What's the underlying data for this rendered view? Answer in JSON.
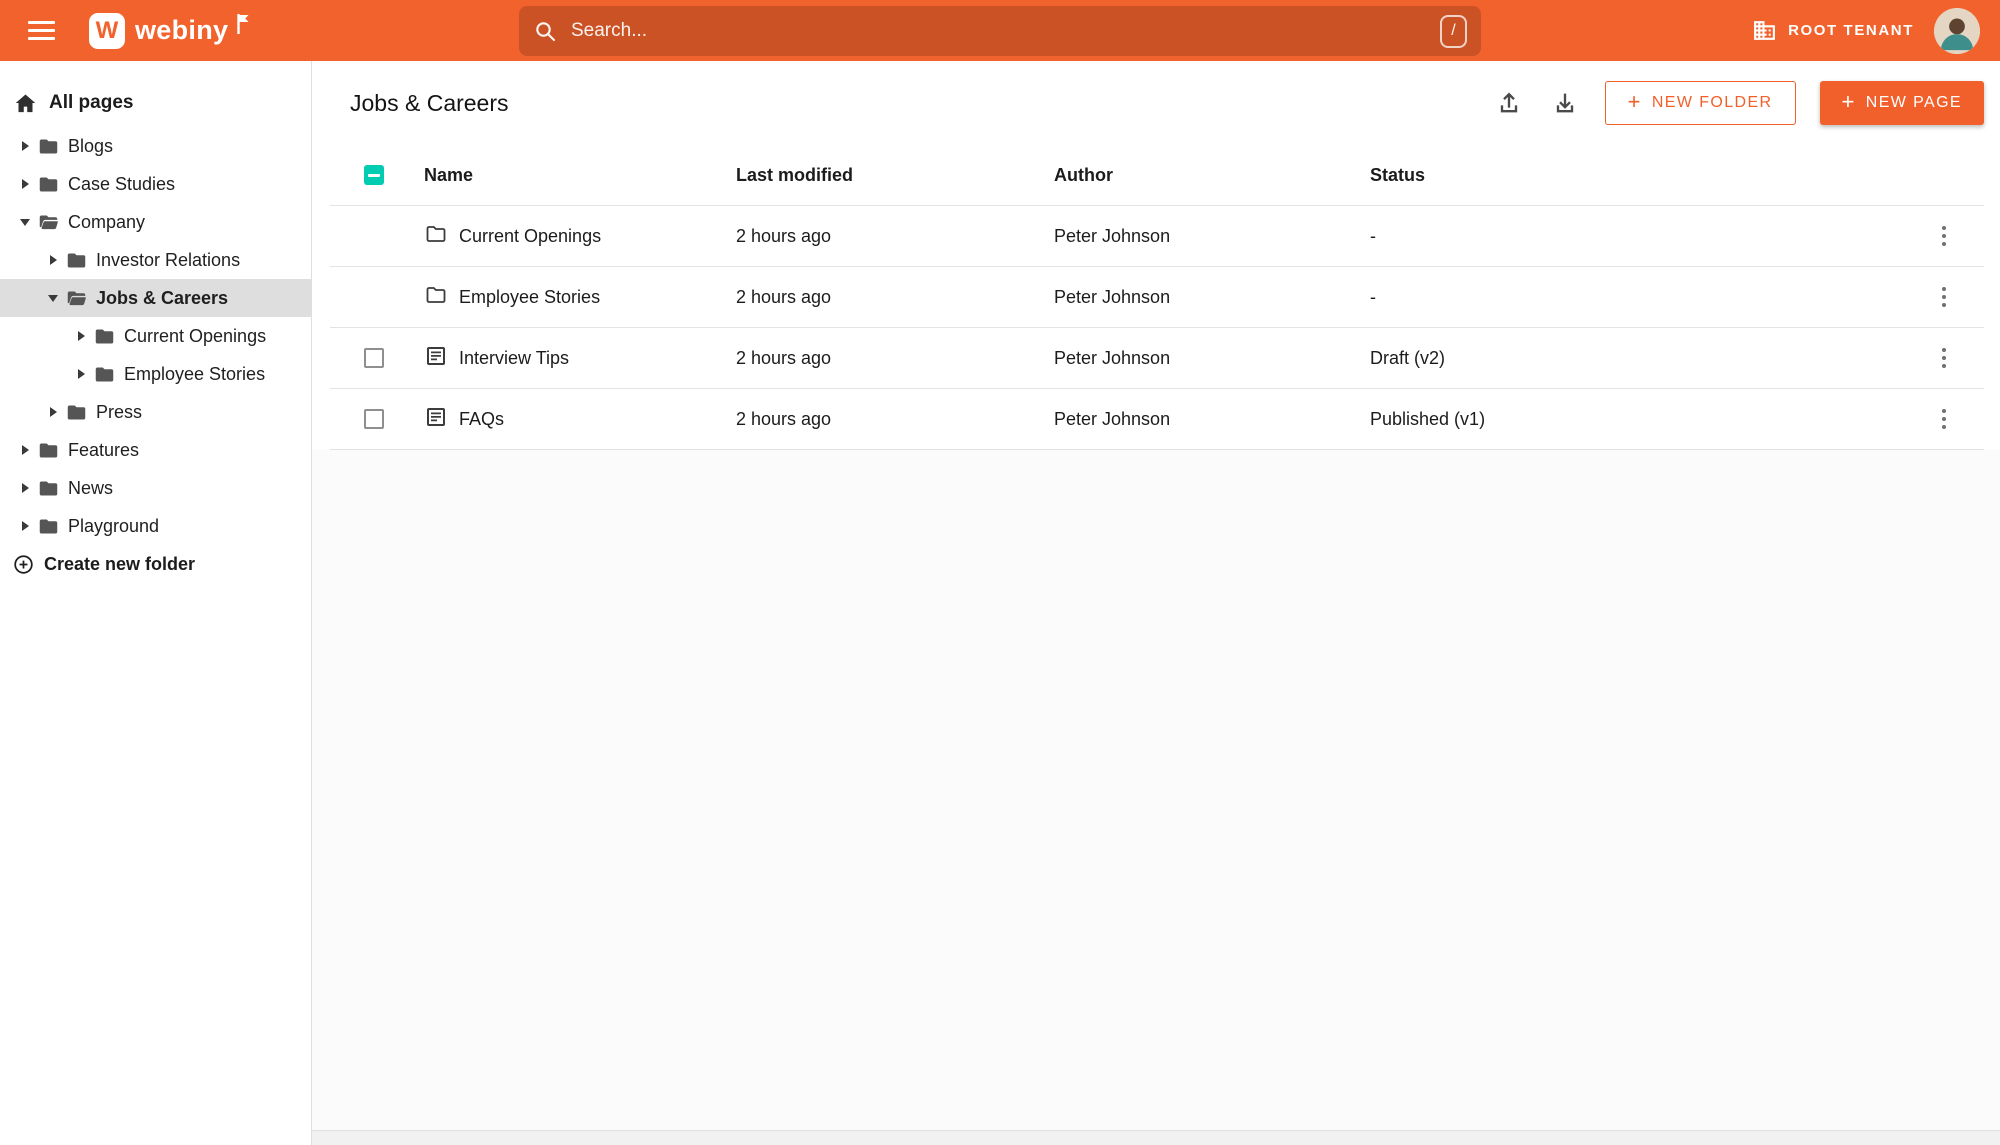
{
  "topbar": {
    "logo": {
      "letter": "W",
      "text": "webiny"
    },
    "search": {
      "placeholder": "Search...",
      "shortcut": "/"
    },
    "tenant_label": "ROOT TENANT"
  },
  "sidebar": {
    "all_pages_label": "All pages",
    "create_folder_label": "Create new folder",
    "items": [
      {
        "label": "Blogs",
        "level": 0,
        "caret": "right",
        "icon": "closed",
        "selected": false
      },
      {
        "label": "Case Studies",
        "level": 0,
        "caret": "right",
        "icon": "closed",
        "selected": false
      },
      {
        "label": "Company",
        "level": 0,
        "caret": "down",
        "icon": "open",
        "selected": false
      },
      {
        "label": "Investor Relations",
        "level": 1,
        "caret": "right",
        "icon": "closed",
        "selected": false
      },
      {
        "label": "Jobs & Careers",
        "level": 1,
        "caret": "down",
        "icon": "open",
        "selected": true
      },
      {
        "label": "Current Openings",
        "level": 2,
        "caret": "right",
        "icon": "closed",
        "selected": false
      },
      {
        "label": "Employee Stories",
        "level": 2,
        "caret": "right",
        "icon": "closed",
        "selected": false
      },
      {
        "label": "Press",
        "level": 1,
        "caret": "right",
        "icon": "closed",
        "selected": false
      },
      {
        "label": "Features",
        "level": 0,
        "caret": "right",
        "icon": "closed",
        "selected": false
      },
      {
        "label": "News",
        "level": 0,
        "caret": "right",
        "icon": "closed",
        "selected": false
      },
      {
        "label": "Playground",
        "level": 0,
        "caret": "right",
        "icon": "closed",
        "selected": false
      }
    ]
  },
  "main": {
    "title": "Jobs & Careers",
    "actions": {
      "plus": "+",
      "new_folder_label": "NEW FOLDER",
      "new_page_label": "NEW PAGE"
    },
    "table": {
      "headers": {
        "name": "Name",
        "modified": "Last modified",
        "author": "Author",
        "status": "Status"
      },
      "rows": [
        {
          "type": "folder",
          "name": "Current Openings",
          "modified": "2 hours ago",
          "author": "Peter Johnson",
          "status": "-"
        },
        {
          "type": "folder",
          "name": "Employee Stories",
          "modified": "2 hours ago",
          "author": "Peter Johnson",
          "status": "-"
        },
        {
          "type": "page",
          "name": "Interview Tips",
          "modified": "2 hours ago",
          "author": "Peter Johnson",
          "status": "Draft (v2)"
        },
        {
          "type": "page",
          "name": "FAQs",
          "modified": "2 hours ago",
          "author": "Peter Johnson",
          "status": "Published (v1)"
        }
      ]
    }
  },
  "colors": {
    "accent": "#F1602B",
    "topbar": "#F2622C",
    "checkbox": "#00CCB2"
  }
}
